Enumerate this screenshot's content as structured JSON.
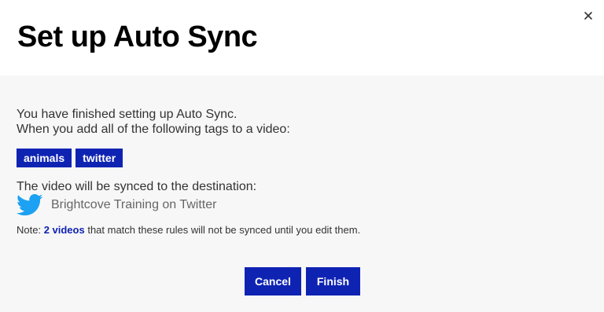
{
  "dialog": {
    "title": "Set up Auto Sync",
    "close_icon": "close-icon"
  },
  "body": {
    "intro_line1": "You have finished setting up Auto Sync.",
    "intro_line2": "When you add all of the following tags to a video:",
    "tags": [
      "animals",
      "twitter"
    ],
    "destination_label": "The video will be synced to the destination:",
    "destination": {
      "icon": "twitter-icon",
      "name": "Brightcove Training on Twitter"
    },
    "note": {
      "prefix": "Note: ",
      "link": "2 videos",
      "suffix": " that match these rules will not be synced until you edit them."
    }
  },
  "actions": {
    "cancel_label": "Cancel",
    "finish_label": "Finish"
  },
  "colors": {
    "accent": "#0f23b3",
    "twitter": "#1da1f2",
    "body_bg": "#f7f7f7"
  }
}
